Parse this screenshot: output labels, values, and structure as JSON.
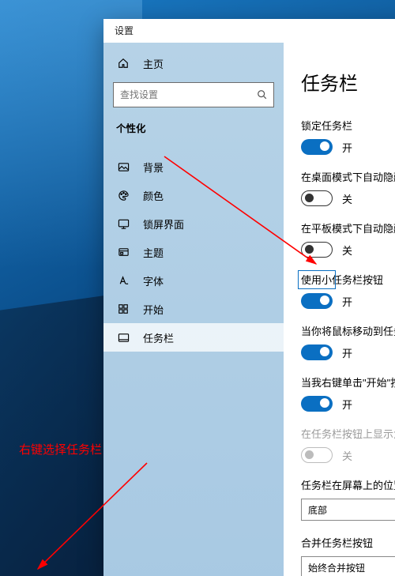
{
  "window": {
    "title": "设置"
  },
  "sidebar": {
    "home_label": "主页",
    "search_placeholder": "查找设置",
    "section_label": "个性化",
    "items": [
      {
        "label": "背景"
      },
      {
        "label": "颜色"
      },
      {
        "label": "锁屏界面"
      },
      {
        "label": "主题"
      },
      {
        "label": "字体"
      },
      {
        "label": "开始"
      },
      {
        "label": "任务栏"
      }
    ]
  },
  "content": {
    "page_title": "任务栏",
    "settings": [
      {
        "label": "锁定任务栏",
        "state": "on",
        "on_text": "开"
      },
      {
        "label": "在桌面模式下自动隐藏任务栏",
        "state": "off",
        "off_text": "关"
      },
      {
        "label": "在平板模式下自动隐藏任务栏",
        "state": "off",
        "off_text": "关"
      },
      {
        "label": "使用小任务栏按钮",
        "state": "on",
        "on_text": "开"
      },
      {
        "label": "当你将鼠标移动到任务栏末端的\"显示桌面\"按钮时，使用\"速览\"预览桌面",
        "state": "on",
        "on_text": "开"
      },
      {
        "label": "当我右键单击\"开始\"按钮或按下 Windows 键+X 时，在菜单中将命令提示符替换为 Windows PowerShell",
        "state": "on",
        "on_text": "开"
      },
      {
        "label": "在任务栏按钮上显示角标",
        "state": "off",
        "off_text": "关",
        "disabled": true
      }
    ],
    "position": {
      "label": "任务栏在屏幕上的位置",
      "value": "底部"
    },
    "combine": {
      "label": "合并任务栏按钮",
      "value": "始终合并按钮"
    }
  },
  "annotations": {
    "context_text": "右键选择任务栏"
  }
}
